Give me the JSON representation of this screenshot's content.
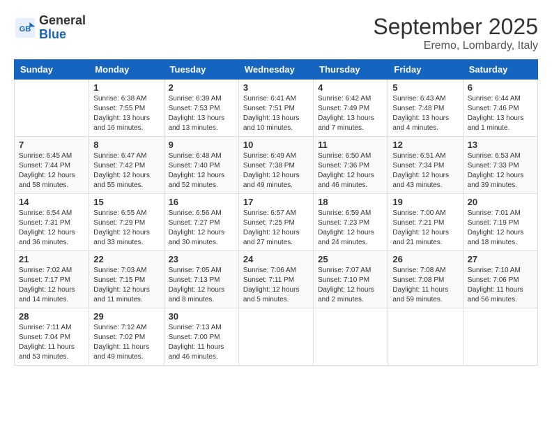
{
  "header": {
    "logo_general": "General",
    "logo_blue": "Blue",
    "month": "September 2025",
    "location": "Eremo, Lombardy, Italy"
  },
  "weekdays": [
    "Sunday",
    "Monday",
    "Tuesday",
    "Wednesday",
    "Thursday",
    "Friday",
    "Saturday"
  ],
  "weeks": [
    [
      {
        "day": "",
        "info": ""
      },
      {
        "day": "1",
        "info": "Sunrise: 6:38 AM\nSunset: 7:55 PM\nDaylight: 13 hours\nand 16 minutes."
      },
      {
        "day": "2",
        "info": "Sunrise: 6:39 AM\nSunset: 7:53 PM\nDaylight: 13 hours\nand 13 minutes."
      },
      {
        "day": "3",
        "info": "Sunrise: 6:41 AM\nSunset: 7:51 PM\nDaylight: 13 hours\nand 10 minutes."
      },
      {
        "day": "4",
        "info": "Sunrise: 6:42 AM\nSunset: 7:49 PM\nDaylight: 13 hours\nand 7 minutes."
      },
      {
        "day": "5",
        "info": "Sunrise: 6:43 AM\nSunset: 7:48 PM\nDaylight: 13 hours\nand 4 minutes."
      },
      {
        "day": "6",
        "info": "Sunrise: 6:44 AM\nSunset: 7:46 PM\nDaylight: 13 hours\nand 1 minute."
      }
    ],
    [
      {
        "day": "7",
        "info": "Sunrise: 6:45 AM\nSunset: 7:44 PM\nDaylight: 12 hours\nand 58 minutes."
      },
      {
        "day": "8",
        "info": "Sunrise: 6:47 AM\nSunset: 7:42 PM\nDaylight: 12 hours\nand 55 minutes."
      },
      {
        "day": "9",
        "info": "Sunrise: 6:48 AM\nSunset: 7:40 PM\nDaylight: 12 hours\nand 52 minutes."
      },
      {
        "day": "10",
        "info": "Sunrise: 6:49 AM\nSunset: 7:38 PM\nDaylight: 12 hours\nand 49 minutes."
      },
      {
        "day": "11",
        "info": "Sunrise: 6:50 AM\nSunset: 7:36 PM\nDaylight: 12 hours\nand 46 minutes."
      },
      {
        "day": "12",
        "info": "Sunrise: 6:51 AM\nSunset: 7:34 PM\nDaylight: 12 hours\nand 43 minutes."
      },
      {
        "day": "13",
        "info": "Sunrise: 6:53 AM\nSunset: 7:33 PM\nDaylight: 12 hours\nand 39 minutes."
      }
    ],
    [
      {
        "day": "14",
        "info": "Sunrise: 6:54 AM\nSunset: 7:31 PM\nDaylight: 12 hours\nand 36 minutes."
      },
      {
        "day": "15",
        "info": "Sunrise: 6:55 AM\nSunset: 7:29 PM\nDaylight: 12 hours\nand 33 minutes."
      },
      {
        "day": "16",
        "info": "Sunrise: 6:56 AM\nSunset: 7:27 PM\nDaylight: 12 hours\nand 30 minutes."
      },
      {
        "day": "17",
        "info": "Sunrise: 6:57 AM\nSunset: 7:25 PM\nDaylight: 12 hours\nand 27 minutes."
      },
      {
        "day": "18",
        "info": "Sunrise: 6:59 AM\nSunset: 7:23 PM\nDaylight: 12 hours\nand 24 minutes."
      },
      {
        "day": "19",
        "info": "Sunrise: 7:00 AM\nSunset: 7:21 PM\nDaylight: 12 hours\nand 21 minutes."
      },
      {
        "day": "20",
        "info": "Sunrise: 7:01 AM\nSunset: 7:19 PM\nDaylight: 12 hours\nand 18 minutes."
      }
    ],
    [
      {
        "day": "21",
        "info": "Sunrise: 7:02 AM\nSunset: 7:17 PM\nDaylight: 12 hours\nand 14 minutes."
      },
      {
        "day": "22",
        "info": "Sunrise: 7:03 AM\nSunset: 7:15 PM\nDaylight: 12 hours\nand 11 minutes."
      },
      {
        "day": "23",
        "info": "Sunrise: 7:05 AM\nSunset: 7:13 PM\nDaylight: 12 hours\nand 8 minutes."
      },
      {
        "day": "24",
        "info": "Sunrise: 7:06 AM\nSunset: 7:11 PM\nDaylight: 12 hours\nand 5 minutes."
      },
      {
        "day": "25",
        "info": "Sunrise: 7:07 AM\nSunset: 7:10 PM\nDaylight: 12 hours\nand 2 minutes."
      },
      {
        "day": "26",
        "info": "Sunrise: 7:08 AM\nSunset: 7:08 PM\nDaylight: 11 hours\nand 59 minutes."
      },
      {
        "day": "27",
        "info": "Sunrise: 7:10 AM\nSunset: 7:06 PM\nDaylight: 11 hours\nand 56 minutes."
      }
    ],
    [
      {
        "day": "28",
        "info": "Sunrise: 7:11 AM\nSunset: 7:04 PM\nDaylight: 11 hours\nand 53 minutes."
      },
      {
        "day": "29",
        "info": "Sunrise: 7:12 AM\nSunset: 7:02 PM\nDaylight: 11 hours\nand 49 minutes."
      },
      {
        "day": "30",
        "info": "Sunrise: 7:13 AM\nSunset: 7:00 PM\nDaylight: 11 hours\nand 46 minutes."
      },
      {
        "day": "",
        "info": ""
      },
      {
        "day": "",
        "info": ""
      },
      {
        "day": "",
        "info": ""
      },
      {
        "day": "",
        "info": ""
      }
    ]
  ]
}
